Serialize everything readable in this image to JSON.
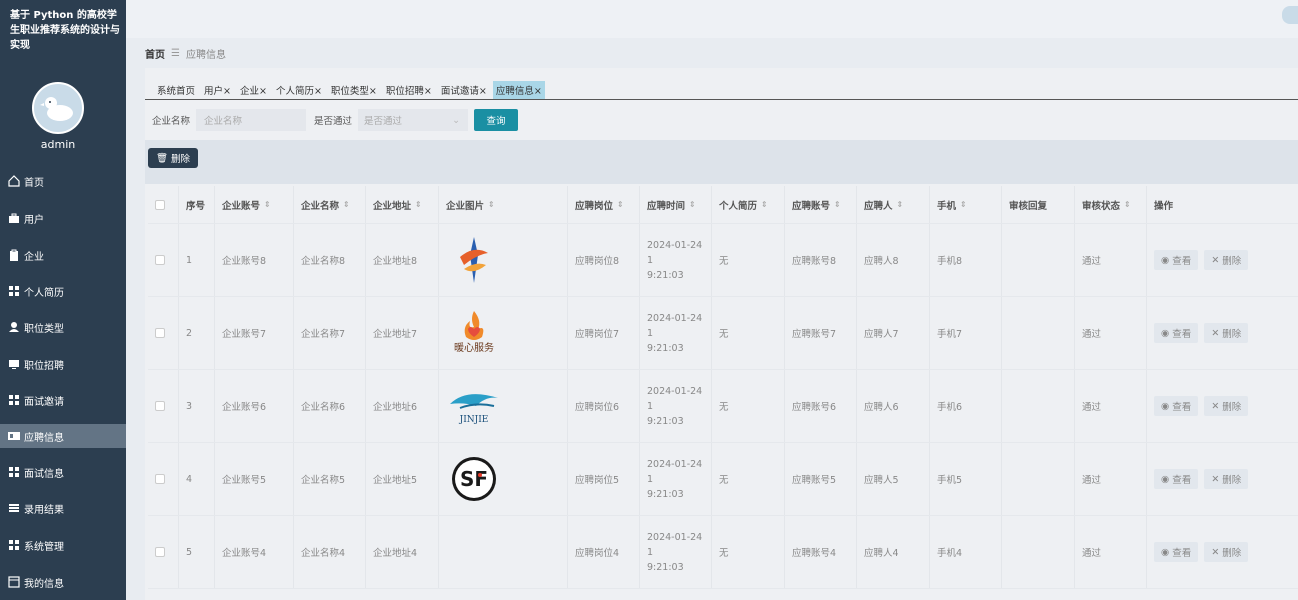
{
  "app": {
    "title": "基于 Python 的高校学生职业推荐系统的设计与实现",
    "username": "admin"
  },
  "sidebar": {
    "items": [
      {
        "label": "首页",
        "icon": "home-icon"
      },
      {
        "label": "用户",
        "icon": "briefcase-icon"
      },
      {
        "label": "企业",
        "icon": "clipboard-icon"
      },
      {
        "label": "个人简历",
        "icon": "grid-icon"
      },
      {
        "label": "职位类型",
        "icon": "user-icon"
      },
      {
        "label": "职位招聘",
        "icon": "monitor-icon"
      },
      {
        "label": "面试邀请",
        "icon": "grid-icon"
      },
      {
        "label": "应聘信息",
        "icon": "id-card-icon"
      },
      {
        "label": "面试信息",
        "icon": "grid-icon"
      },
      {
        "label": "录用结果",
        "icon": "list-icon"
      },
      {
        "label": "系统管理",
        "icon": "grid-icon"
      },
      {
        "label": "我的信息",
        "icon": "window-icon"
      }
    ]
  },
  "breadcrumb": {
    "home": "首页",
    "sep": "☰",
    "current": "应聘信息"
  },
  "tabs": [
    {
      "label": "系统首页"
    },
    {
      "label": "用户×"
    },
    {
      "label": "企业×"
    },
    {
      "label": "个人简历×"
    },
    {
      "label": "职位类型×"
    },
    {
      "label": "职位招聘×"
    },
    {
      "label": "面试邀请×"
    },
    {
      "label": "应聘信息×"
    }
  ],
  "search": {
    "company_label": "企业名称",
    "company_placeholder": "企业名称",
    "passed_label": "是否通过",
    "passed_placeholder": "是否通过",
    "search_button": "查询"
  },
  "toolbar": {
    "delete_label": "删除"
  },
  "table": {
    "headers": [
      "序号",
      "企业账号",
      "企业名称",
      "企业地址",
      "企业图片",
      "应聘岗位",
      "应聘时间",
      "个人简历",
      "应聘账号",
      "应聘人",
      "手机",
      "审核回复",
      "审核状态",
      "操作"
    ],
    "view_label": "查看",
    "delete_label": "删除",
    "rows": [
      {
        "no": "1",
        "account": "企业账号8",
        "name": "企业名称8",
        "address": "企业地址8",
        "logo": "logo-a-icon",
        "post": "应聘岗位8",
        "time": "2024-01-24 1\n9:21:03",
        "resume": "无",
        "applicant_account": "应聘账号8",
        "applicant": "应聘人8",
        "phone": "手机8",
        "reply": "",
        "status": "通过"
      },
      {
        "no": "2",
        "account": "企业账号7",
        "name": "企业名称7",
        "address": "企业地址7",
        "logo": "logo-b-icon",
        "logo_text": "暖心服务",
        "post": "应聘岗位7",
        "time": "2024-01-24 1\n9:21:03",
        "resume": "无",
        "applicant_account": "应聘账号7",
        "applicant": "应聘人7",
        "phone": "手机7",
        "reply": "",
        "status": "通过"
      },
      {
        "no": "3",
        "account": "企业账号6",
        "name": "企业名称6",
        "address": "企业地址6",
        "logo": "logo-c-icon",
        "logo_text": "JINJIE",
        "post": "应聘岗位6",
        "time": "2024-01-24 1\n9:21:03",
        "resume": "无",
        "applicant_account": "应聘账号6",
        "applicant": "应聘人6",
        "phone": "手机6",
        "reply": "",
        "status": "通过"
      },
      {
        "no": "4",
        "account": "企业账号5",
        "name": "企业名称5",
        "address": "企业地址5",
        "logo": "logo-d-icon",
        "logo_text": "SF",
        "post": "应聘岗位5",
        "time": "2024-01-24 1\n9:21:03",
        "resume": "无",
        "applicant_account": "应聘账号5",
        "applicant": "应聘人5",
        "phone": "手机5",
        "reply": "",
        "status": "通过"
      },
      {
        "no": "5",
        "account": "企业账号4",
        "name": "企业名称4",
        "address": "企业地址4",
        "logo": "",
        "post": "应聘岗位4",
        "time": "2024-01-24 1\n9:21:03",
        "resume": "无",
        "applicant_account": "应聘账号4",
        "applicant": "应聘人4",
        "phone": "手机4",
        "reply": "",
        "status": "通过"
      }
    ]
  }
}
